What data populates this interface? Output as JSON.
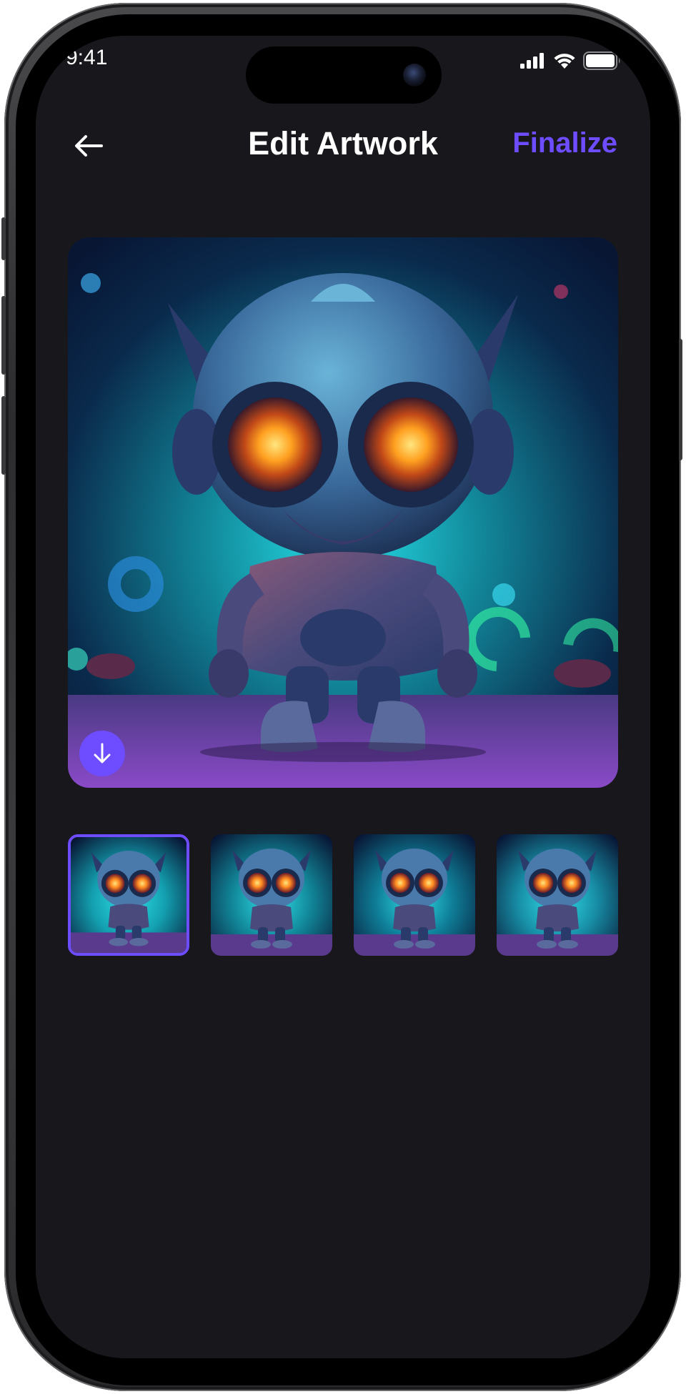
{
  "status_bar": {
    "time": "9:41"
  },
  "header": {
    "title": "Edit Artwork",
    "finalize_label": "Finalize"
  },
  "icons": {
    "back": "arrow-left-icon",
    "download": "arrow-down-icon",
    "signal": "cellular-signal-icon",
    "wifi": "wifi-icon",
    "battery": "battery-icon"
  },
  "thumbnails": {
    "count": 4,
    "selected_index": 0
  },
  "colors": {
    "accent": "#6e4cff",
    "background": "#17171c",
    "text": "#ffffff"
  }
}
